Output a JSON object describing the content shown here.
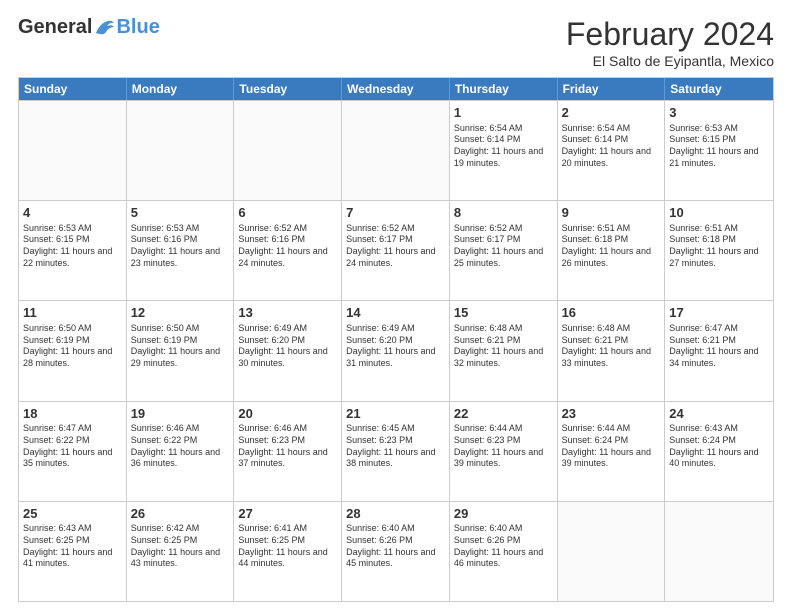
{
  "logo": {
    "general": "General",
    "blue": "Blue"
  },
  "header": {
    "month": "February 2024",
    "location": "El Salto de Eyipantla, Mexico"
  },
  "days": [
    "Sunday",
    "Monday",
    "Tuesday",
    "Wednesday",
    "Thursday",
    "Friday",
    "Saturday"
  ],
  "weeks": [
    [
      {
        "day": "",
        "text": ""
      },
      {
        "day": "",
        "text": ""
      },
      {
        "day": "",
        "text": ""
      },
      {
        "day": "",
        "text": ""
      },
      {
        "day": "1",
        "text": "Sunrise: 6:54 AM\nSunset: 6:14 PM\nDaylight: 11 hours and 19 minutes."
      },
      {
        "day": "2",
        "text": "Sunrise: 6:54 AM\nSunset: 6:14 PM\nDaylight: 11 hours and 20 minutes."
      },
      {
        "day": "3",
        "text": "Sunrise: 6:53 AM\nSunset: 6:15 PM\nDaylight: 11 hours and 21 minutes."
      }
    ],
    [
      {
        "day": "4",
        "text": "Sunrise: 6:53 AM\nSunset: 6:15 PM\nDaylight: 11 hours and 22 minutes."
      },
      {
        "day": "5",
        "text": "Sunrise: 6:53 AM\nSunset: 6:16 PM\nDaylight: 11 hours and 23 minutes."
      },
      {
        "day": "6",
        "text": "Sunrise: 6:52 AM\nSunset: 6:16 PM\nDaylight: 11 hours and 24 minutes."
      },
      {
        "day": "7",
        "text": "Sunrise: 6:52 AM\nSunset: 6:17 PM\nDaylight: 11 hours and 24 minutes."
      },
      {
        "day": "8",
        "text": "Sunrise: 6:52 AM\nSunset: 6:17 PM\nDaylight: 11 hours and 25 minutes."
      },
      {
        "day": "9",
        "text": "Sunrise: 6:51 AM\nSunset: 6:18 PM\nDaylight: 11 hours and 26 minutes."
      },
      {
        "day": "10",
        "text": "Sunrise: 6:51 AM\nSunset: 6:18 PM\nDaylight: 11 hours and 27 minutes."
      }
    ],
    [
      {
        "day": "11",
        "text": "Sunrise: 6:50 AM\nSunset: 6:19 PM\nDaylight: 11 hours and 28 minutes."
      },
      {
        "day": "12",
        "text": "Sunrise: 6:50 AM\nSunset: 6:19 PM\nDaylight: 11 hours and 29 minutes."
      },
      {
        "day": "13",
        "text": "Sunrise: 6:49 AM\nSunset: 6:20 PM\nDaylight: 11 hours and 30 minutes."
      },
      {
        "day": "14",
        "text": "Sunrise: 6:49 AM\nSunset: 6:20 PM\nDaylight: 11 hours and 31 minutes."
      },
      {
        "day": "15",
        "text": "Sunrise: 6:48 AM\nSunset: 6:21 PM\nDaylight: 11 hours and 32 minutes."
      },
      {
        "day": "16",
        "text": "Sunrise: 6:48 AM\nSunset: 6:21 PM\nDaylight: 11 hours and 33 minutes."
      },
      {
        "day": "17",
        "text": "Sunrise: 6:47 AM\nSunset: 6:21 PM\nDaylight: 11 hours and 34 minutes."
      }
    ],
    [
      {
        "day": "18",
        "text": "Sunrise: 6:47 AM\nSunset: 6:22 PM\nDaylight: 11 hours and 35 minutes."
      },
      {
        "day": "19",
        "text": "Sunrise: 6:46 AM\nSunset: 6:22 PM\nDaylight: 11 hours and 36 minutes."
      },
      {
        "day": "20",
        "text": "Sunrise: 6:46 AM\nSunset: 6:23 PM\nDaylight: 11 hours and 37 minutes."
      },
      {
        "day": "21",
        "text": "Sunrise: 6:45 AM\nSunset: 6:23 PM\nDaylight: 11 hours and 38 minutes."
      },
      {
        "day": "22",
        "text": "Sunrise: 6:44 AM\nSunset: 6:23 PM\nDaylight: 11 hours and 39 minutes."
      },
      {
        "day": "23",
        "text": "Sunrise: 6:44 AM\nSunset: 6:24 PM\nDaylight: 11 hours and 39 minutes."
      },
      {
        "day": "24",
        "text": "Sunrise: 6:43 AM\nSunset: 6:24 PM\nDaylight: 11 hours and 40 minutes."
      }
    ],
    [
      {
        "day": "25",
        "text": "Sunrise: 6:43 AM\nSunset: 6:25 PM\nDaylight: 11 hours and 41 minutes."
      },
      {
        "day": "26",
        "text": "Sunrise: 6:42 AM\nSunset: 6:25 PM\nDaylight: 11 hours and 43 minutes."
      },
      {
        "day": "27",
        "text": "Sunrise: 6:41 AM\nSunset: 6:25 PM\nDaylight: 11 hours and 44 minutes."
      },
      {
        "day": "28",
        "text": "Sunrise: 6:40 AM\nSunset: 6:26 PM\nDaylight: 11 hours and 45 minutes."
      },
      {
        "day": "29",
        "text": "Sunrise: 6:40 AM\nSunset: 6:26 PM\nDaylight: 11 hours and 46 minutes."
      },
      {
        "day": "",
        "text": ""
      },
      {
        "day": "",
        "text": ""
      }
    ]
  ]
}
